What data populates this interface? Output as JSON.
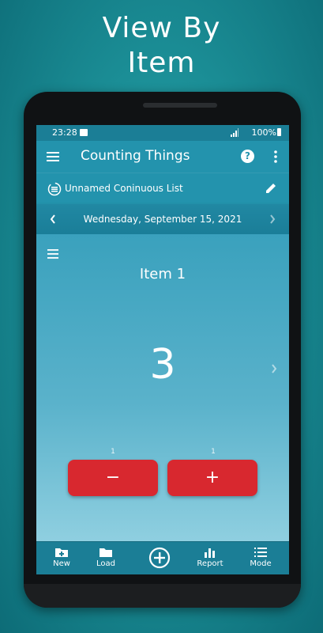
{
  "promo": {
    "title_line1": "View By",
    "title_line2": "Item"
  },
  "status_bar": {
    "time": "23:28",
    "battery": "100%"
  },
  "app_bar": {
    "title": "Counting Things",
    "menu_icon": "hamburger-menu-icon",
    "help_icon": "help-circle-icon",
    "more_icon": "more-vert-icon"
  },
  "list_bar": {
    "name": "Unnamed Coninuous List",
    "list_icon": "continuous-list-icon",
    "edit_icon": "pencil-icon"
  },
  "date_bar": {
    "date": "Wednesday, September 15, 2021"
  },
  "counter": {
    "item_name": "Item 1",
    "count": "3",
    "decrement_step": "1",
    "increment_step": "1",
    "decrement_label": "−",
    "increment_label": "+"
  },
  "bottom_nav": {
    "new": "New",
    "load": "Load",
    "report": "Report",
    "mode": "Mode"
  },
  "colors": {
    "app_bar": "#2393ad",
    "button_red": "#d8282f",
    "status_bar": "#1b7e96"
  }
}
